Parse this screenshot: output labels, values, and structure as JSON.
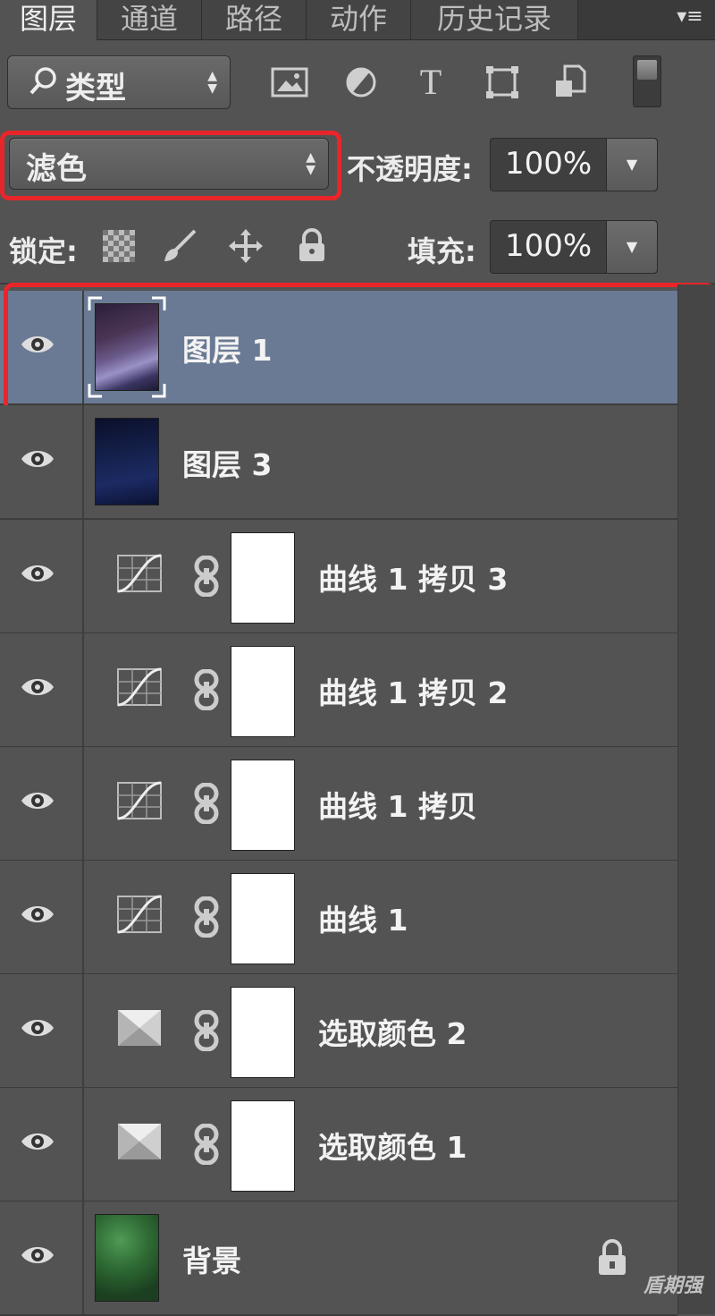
{
  "tabs": [
    "图层",
    "通道",
    "路径",
    "动作",
    "历史记录"
  ],
  "filter": {
    "kind_label": "类型"
  },
  "blend": {
    "mode": "滤色",
    "opacity_label": "不透明度:",
    "opacity_value": "100%"
  },
  "lock": {
    "label": "锁定:",
    "fill_label": "填充:",
    "fill_value": "100%"
  },
  "layers": [
    {
      "name": "图层 1",
      "kind": "pixel",
      "selected": true
    },
    {
      "name": "图层 3",
      "kind": "pixel"
    },
    {
      "name": "曲线 1 拷贝 3",
      "kind": "curves"
    },
    {
      "name": "曲线 1 拷贝 2",
      "kind": "curves"
    },
    {
      "name": "曲线 1 拷贝",
      "kind": "curves"
    },
    {
      "name": "曲线 1",
      "kind": "curves"
    },
    {
      "name": "选取颜色 2",
      "kind": "selective-color"
    },
    {
      "name": "选取颜色 1",
      "kind": "selective-color"
    },
    {
      "name": "背景",
      "kind": "background",
      "locked": true
    }
  ],
  "watermark": "盾期强",
  "colors": {
    "selected_row": "#6a7a94",
    "highlight": "#e8262a",
    "panel": "#535353"
  }
}
